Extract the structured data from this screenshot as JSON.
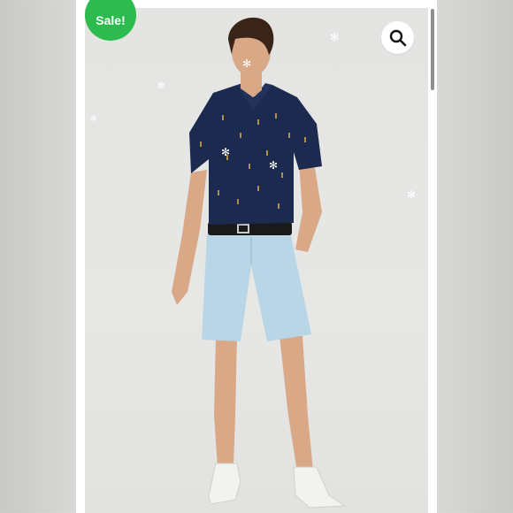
{
  "badge": {
    "label": "Sale!"
  },
  "zoom": {
    "icon": "magnifier-icon"
  },
  "photo": {
    "subject": "product-photo",
    "colors": {
      "shirt": "#1b2a4e",
      "shorts": "#b8d6e6",
      "belt": "#1a1a1a",
      "shoes": "#f2f2f0",
      "skin": "#d8a887",
      "hair": "#3a2418",
      "backdrop": "#e5e5e3"
    }
  },
  "accent": {
    "sale_green": "#2dbb4f"
  }
}
